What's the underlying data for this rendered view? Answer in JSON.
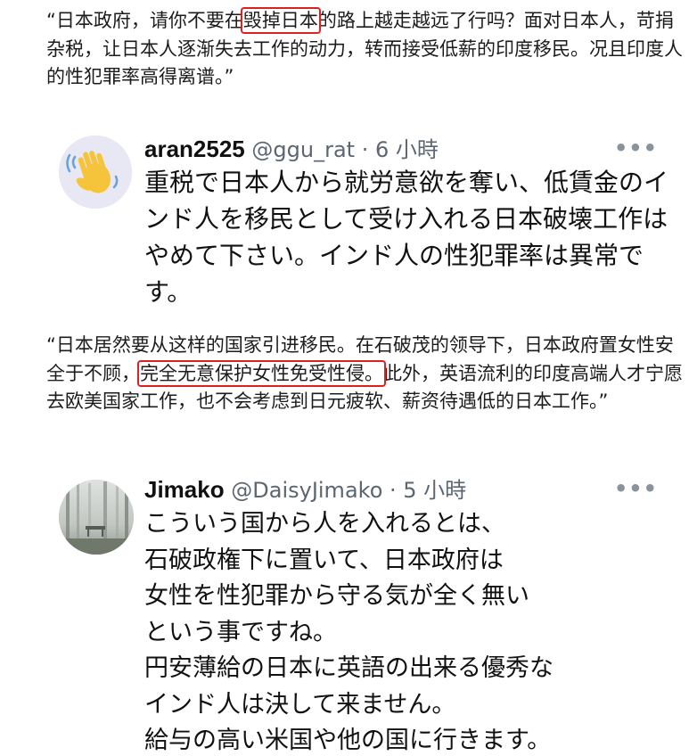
{
  "quote1": {
    "pre": "“日本政府，请你不要在",
    "highlight": "毁掉日本",
    "post": "的路上越走越远了行吗？面对日本人，苛捐杂税，让日本人逐渐失去工作的动力，转而接受低薪的印度移民。况且印度人的性犯罪率高得离谱。”"
  },
  "tweet1": {
    "name": "aran2525",
    "handle": "@ggu_rat",
    "time": "· 6 小時",
    "avatar_icon": "waving-hand-icon",
    "body_lines": [
      "重税で日本人から就労意欲を奪い、低賃金のイ",
      "ンド人を移民として受け入れる日本破壊工作は",
      "やめて下さい。インド人の性犯罪率は異常で",
      "す。"
    ]
  },
  "quote2": {
    "pre": "“日本居然要从这样的国家引进移民。在石破茂的领导下，日本政府置女性安全于不顾，",
    "highlight": "完全无意保护女性免受性侵。",
    "post": "此外，英语流利的印度高端人才宁愿去欧美国家工作，也不会考虑到日元疲软、薪资待遇低的日本工作。”"
  },
  "tweet2": {
    "name": "Jimako",
    "handle": "@DaisyJimako",
    "time": "· 5 小時",
    "avatar_icon": "foggy-forest-photo",
    "body_lines": [
      "こういう国から人を入れるとは、",
      "石破政権下に置いて、日本政府は",
      "女性を性犯罪から守る気が全く無い",
      "という事ですね。",
      "円安薄給の日本に英語の出来る優秀な",
      "インド人は決して来ません。",
      "給与の高い米国や他の国に行きます。"
    ]
  },
  "ui": {
    "more_icon": "more-options-icon",
    "highlight_color": "#e02020",
    "handle_color": "#5b6670"
  }
}
